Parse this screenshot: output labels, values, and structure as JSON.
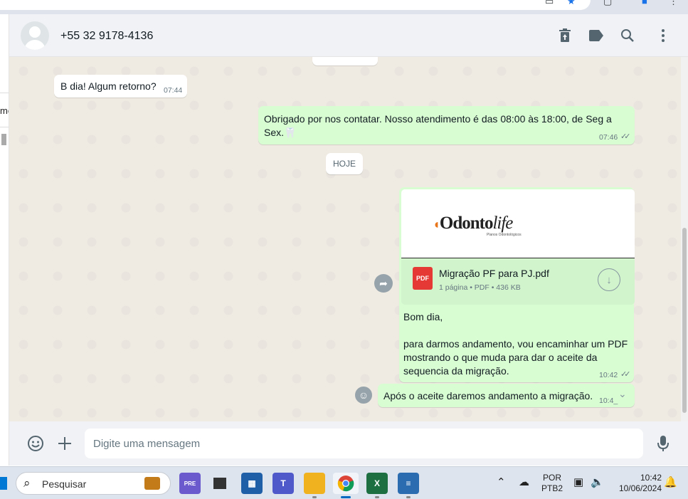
{
  "chat": {
    "contact": "+55 32 9178-4136"
  },
  "left_fragment": "me",
  "messages": [
    {
      "id": "m1",
      "dir": "in",
      "text": "B dia! Algum retorno?",
      "time": "07:44"
    },
    {
      "id": "m2",
      "dir": "out",
      "text": "Obrigado por nos contatar. Nosso atendimento é das 08:00 às 18:00, de Seg a Sex.🦷",
      "time": "07:46",
      "ticks": "✓✓"
    },
    {
      "id": "m4",
      "dir": "out",
      "text": "Após o aceite daremos andamento a migração.",
      "time": "10:4_"
    }
  ],
  "day_separator": "HOJE",
  "document": {
    "logo_text_1": "Odonto",
    "logo_text_2": "life",
    "logo_subtitle": "Planos Odontológicos",
    "file_type_badge": "PDF",
    "file_name": "Migração PF para PJ.pdf",
    "file_meta": "1 página • PDF • 436 KB",
    "caption": "Bom dia,\n\npara darmos andamento, vou encaminhar um PDF mostrando o que muda para dar o aceite da sequencia da migração.",
    "time": "10:42",
    "ticks": "✓✓"
  },
  "composer": {
    "placeholder": "Digite uma mensagem"
  },
  "taskbar": {
    "search_placeholder": "Pesquisar",
    "lang_top": "POR",
    "lang_bottom": "PTB2",
    "clock_time": "10:42",
    "clock_date": "10/06/2024",
    "apps": [
      {
        "name": "copilot",
        "label": "PRE",
        "color": "#6a5acd"
      },
      {
        "name": "task-view",
        "label": "",
        "color": "#333333"
      },
      {
        "name": "store",
        "label": "",
        "color": "#1f5fa8"
      },
      {
        "name": "teams",
        "label": "T",
        "color": "#5059c9"
      },
      {
        "name": "file-explorer",
        "label": "",
        "color": "#f0b21e"
      },
      {
        "name": "chrome",
        "label": "",
        "color": "#1a73e8"
      },
      {
        "name": "excel",
        "label": "X",
        "color": "#1d6f42"
      },
      {
        "name": "notepad",
        "label": "",
        "color": "#2b6cb0"
      }
    ]
  },
  "icons": {
    "delete": "trash-icon",
    "label": "label-icon",
    "search": "search-icon",
    "menu": "menu-icon",
    "emoji": "emoji-icon",
    "attach": "plus-icon",
    "mic": "mic-icon"
  }
}
